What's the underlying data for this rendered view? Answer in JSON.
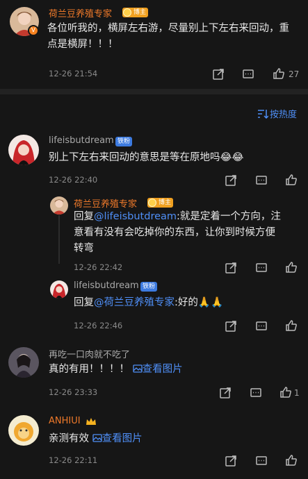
{
  "comments": [
    {
      "name": "荷兰豆养殖专家",
      "badge": "博主",
      "text": "各位听我的，横屏左右游，尽量别上下左右来回动，重点是横屏！！！",
      "time": "12-26 21:54",
      "likes": "27"
    }
  ],
  "sort_label": "按热度",
  "thread": {
    "name": "lifeisbutdream",
    "badge": "铁粉",
    "text": "别上下左右来回动的意思是等在原地吗😂😂",
    "time": "12-26 22:40",
    "replies": [
      {
        "name": "荷兰豆养殖专家",
        "badge": "博主",
        "prefix": "回复",
        "mention": "@lifeisbutdream",
        "text": ":就是定着一个方向，注意看有没有会吃掉你的东西，让你到时候方便转弯",
        "time": "12-26 22:42"
      },
      {
        "name": "lifeisbutdream",
        "badge": "铁粉",
        "prefix": "回复",
        "mention": "@荷兰豆养殖专家",
        "text": ":好的🙏🙏",
        "time": "12-26 22:46"
      }
    ]
  },
  "c3": {
    "name": "再吃一口肉就不吃了",
    "text": "真的有用！！！！",
    "image_link": "查看图片",
    "time": "12-26 23:33",
    "likes": "1"
  },
  "c4": {
    "name": "ANHIUI",
    "text": "亲测有效",
    "image_link": "查看图片",
    "time": "12-26 22:11"
  },
  "icons": [
    "share-icon",
    "comment-icon",
    "like-icon",
    "sort-icon",
    "image-icon",
    "crown-icon"
  ],
  "colors": {
    "accent": "#4f8ff7",
    "orange_name": "#f07a2a",
    "bg": "#161616"
  }
}
